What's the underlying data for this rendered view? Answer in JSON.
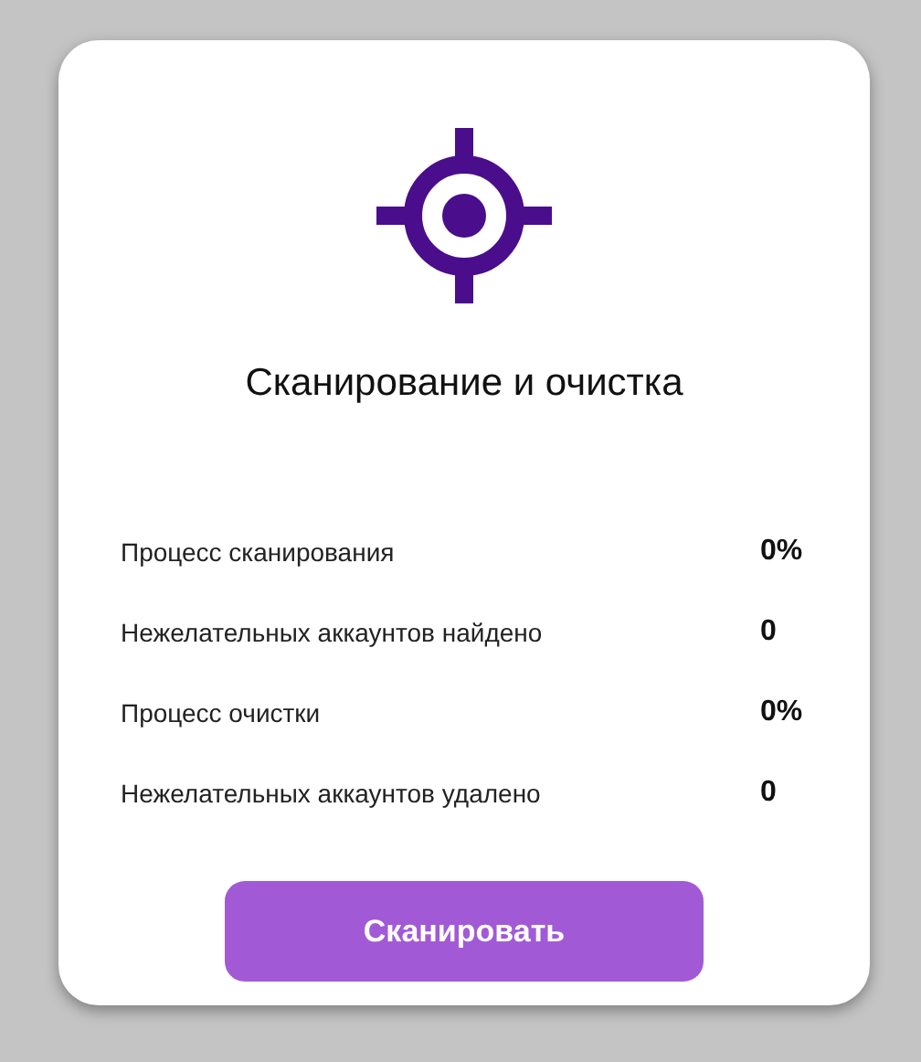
{
  "title": "Сканирование и очистка",
  "stats": [
    {
      "label": "Процесс сканирования",
      "value": "0%"
    },
    {
      "label": "Нежелательных аккаунтов найдено",
      "value": "0"
    },
    {
      "label": "Процесс очистки",
      "value": "0%"
    },
    {
      "label": "Нежелательных аккаунтов удалено",
      "value": "0"
    }
  ],
  "button": "Сканировать"
}
